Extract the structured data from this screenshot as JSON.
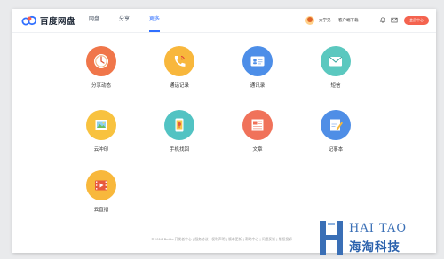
{
  "header": {
    "logo_text": "百度网盘",
    "nav": [
      {
        "label": "网盘",
        "active": false
      },
      {
        "label": "分享",
        "active": false
      },
      {
        "label": "更多",
        "active": true
      }
    ],
    "username": "大学见",
    "client_download": "客户端下载",
    "member_button": "会员中心"
  },
  "apps": [
    {
      "label": "分享动态",
      "icon": "clock-icon",
      "color": "#f0764a"
    },
    {
      "label": "通话记录",
      "icon": "phone-icon",
      "color": "#f8b73c"
    },
    {
      "label": "通讯录",
      "icon": "contact-card-icon",
      "color": "#4d8ee8"
    },
    {
      "label": "短信",
      "icon": "envelope-icon",
      "color": "#5bc8bf"
    },
    {
      "label": "云冲印",
      "icon": "photo-icon",
      "color": "#f8c23f"
    },
    {
      "label": "手机找回",
      "icon": "phone-locate-icon",
      "color": "#52c3c3"
    },
    {
      "label": "文章",
      "icon": "article-icon",
      "color": "#f0725a"
    },
    {
      "label": "记事本",
      "icon": "notepad-icon",
      "color": "#4f8ee6"
    },
    {
      "label": "云直播",
      "icon": "film-icon",
      "color": "#f8b83c"
    }
  ],
  "footer": "©2016 Baidu 开发者中心 | 服务协议 | 权利声明 | 版本更新 | 帮助中心 | 问题反馈 | 版权投诉",
  "watermark": {
    "top": "HAI TAO",
    "bottom": "海淘科技"
  }
}
